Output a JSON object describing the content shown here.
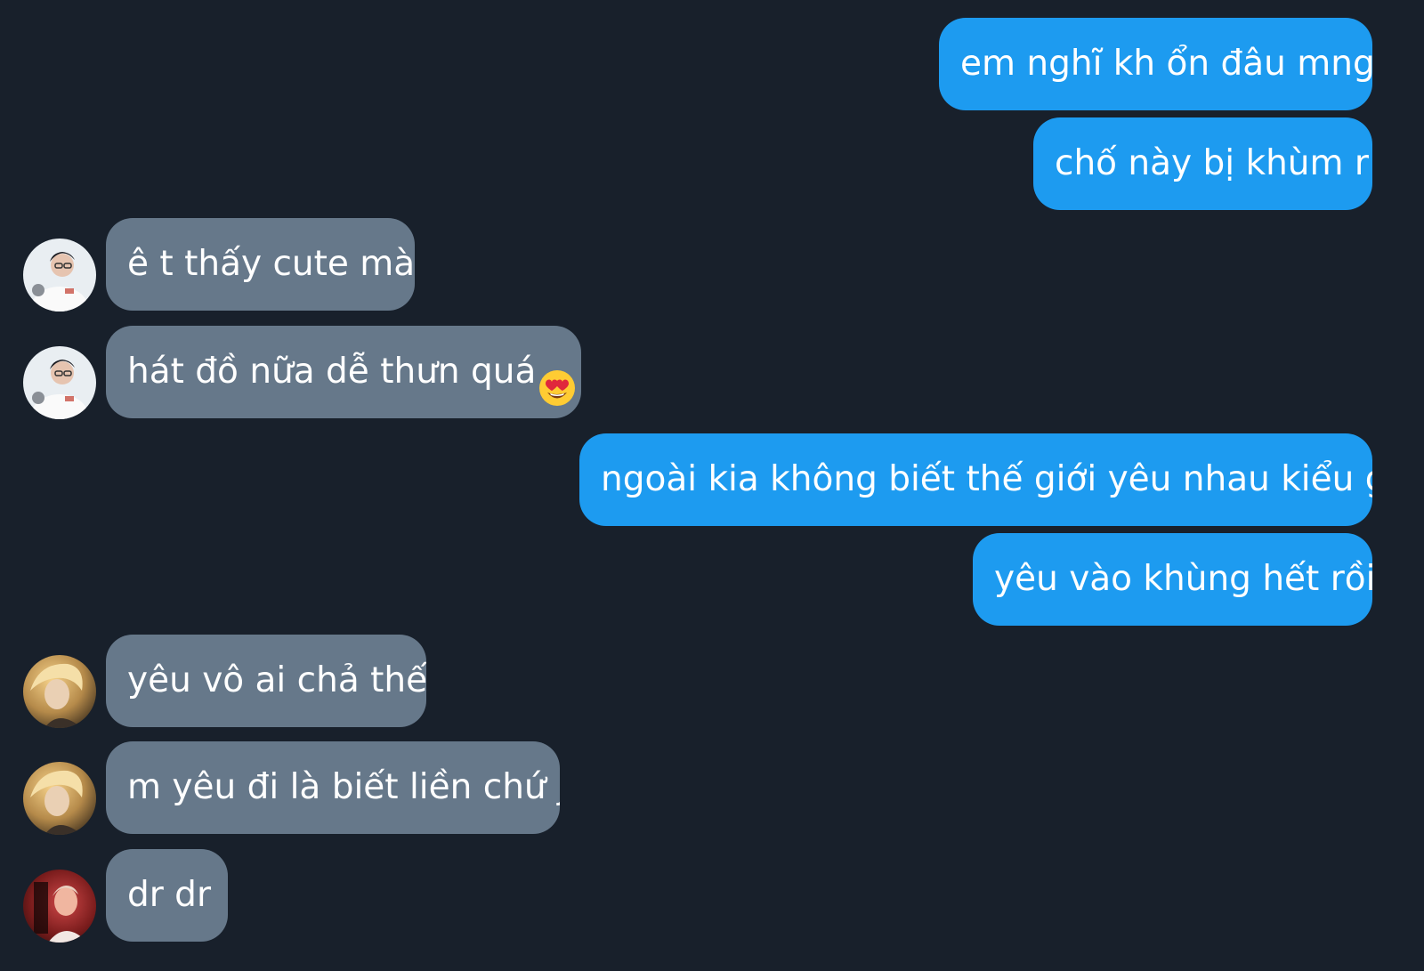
{
  "conversation": {
    "messages": [
      {
        "direction": "sent",
        "text": "em nghĩ kh ổn đâu mng"
      },
      {
        "direction": "sent",
        "text": "chố này bị khùm r"
      },
      {
        "direction": "received",
        "sender_avatar": "avatar-person-white-shirt",
        "text": "ê t thấy cute mà"
      },
      {
        "direction": "received",
        "sender_avatar": "avatar-person-white-shirt",
        "text": "hát đồ nữa dễ thưn quá",
        "emoji": "heart-eyes-emoji"
      },
      {
        "direction": "sent",
        "text": "ngoài kia không biết thế giới yêu nhau kiểu gì"
      },
      {
        "direction": "sent",
        "text": "yêu vào khùng hết rồi"
      },
      {
        "direction": "received",
        "sender_avatar": "avatar-blonde-person",
        "text": "yêu vô ai chả thế"
      },
      {
        "direction": "received",
        "sender_avatar": "avatar-blonde-person",
        "text": "m yêu đi là biết liền chứ j"
      },
      {
        "direction": "received",
        "sender_avatar": "avatar-red-tone-person",
        "text": "dr dr"
      }
    ]
  },
  "colors": {
    "background": "#18202b",
    "sent_bubble": "#1d9bf0",
    "received_bubble": "#66788a",
    "text": "#ffffff"
  }
}
